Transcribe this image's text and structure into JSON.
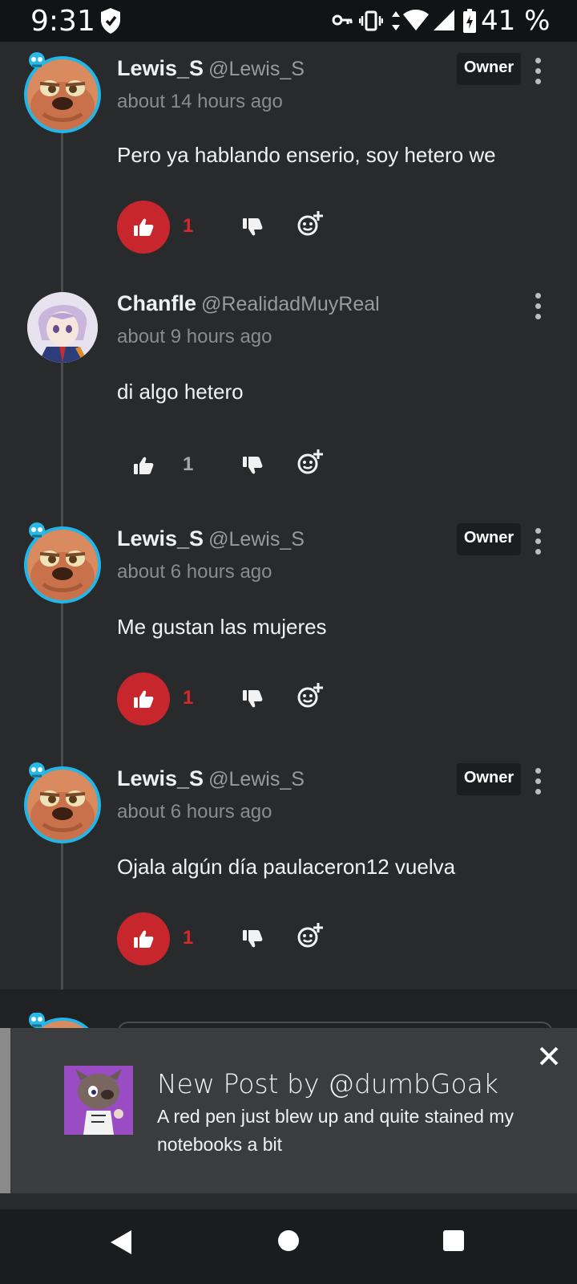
{
  "status_bar": {
    "time": "9:31",
    "battery": "41 %",
    "icons": [
      "shield-icon",
      "vpn-key-icon",
      "vibrate-icon",
      "data-arrows-icon",
      "wifi-icon",
      "signal-icon",
      "battery-charging-icon"
    ]
  },
  "comments": [
    {
      "name": "Lewis_S",
      "handle": "@Lewis_S",
      "time": "about 14 hours ago",
      "text": "Pero ya hablando enserio, soy hetero we",
      "owner_label": "Owner",
      "likes": "1",
      "liked": true
    },
    {
      "name": "Chanfle",
      "handle": "@RealidadMuyReal",
      "time": "about 9 hours ago",
      "text": "di algo hetero",
      "owner_label": "",
      "likes": "1",
      "liked": false
    },
    {
      "name": "Lewis_S",
      "handle": "@Lewis_S",
      "time": "about 6 hours ago",
      "text": "Me gustan las mujeres",
      "owner_label": "Owner",
      "likes": "1",
      "liked": true
    },
    {
      "name": "Lewis_S",
      "handle": "@Lewis_S",
      "time": "about 6 hours ago",
      "text": "Ojala algún día paulaceron12 vuelva",
      "owner_label": "Owner",
      "likes": "1",
      "liked": true
    }
  ],
  "notification": {
    "title": "New Post by @dumbGoak",
    "text": "A red pen just blew up and quite stained my notebooks a bit"
  },
  "colors": {
    "like_active": "#c8262d",
    "owner_ring": "#21b6e9",
    "background": "#282a2c"
  }
}
